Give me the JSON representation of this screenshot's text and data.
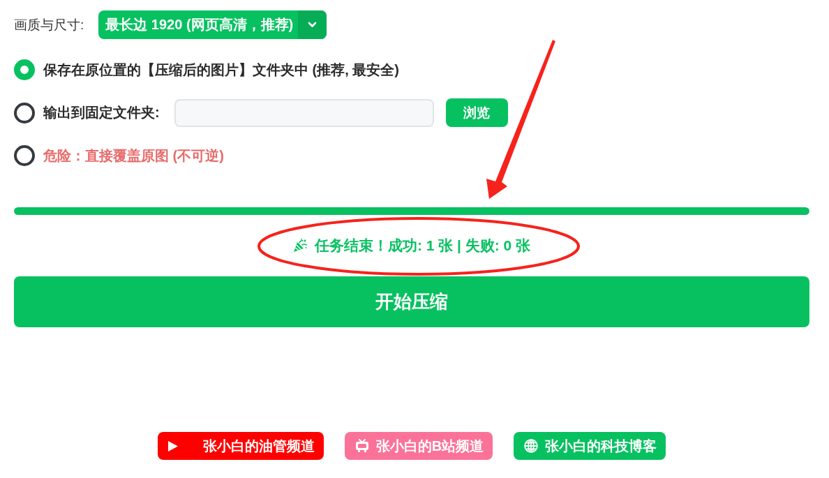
{
  "quality": {
    "label": "画质与尺寸:",
    "value": "最长边 1920 (网页高清，推荐)"
  },
  "save_options": [
    {
      "label": "保存在原位置的【压缩后的图片】文件夹中 (推荐, 最安全)",
      "kind": "plain",
      "selected": true
    },
    {
      "label": "输出到固定文件夹:",
      "kind": "folder",
      "selected": false,
      "button": "浏览"
    },
    {
      "label": "危险：直接覆盖原图 (不可逆)",
      "kind": "danger",
      "selected": false
    }
  ],
  "progress": {
    "level": 1
  },
  "status": {
    "text": "任务结束！成功: 1 张 | 失败: 0 张"
  },
  "start_button": "开始压缩",
  "links": [
    {
      "label": "张小白的油管频道",
      "kind": "video",
      "color": "#ff0000"
    },
    {
      "label": "张小白的B站频道",
      "kind": "tv",
      "color": "#fb7299"
    },
    {
      "label": "张小白的科技博客",
      "kind": "web",
      "color": "#07c160"
    }
  ]
}
